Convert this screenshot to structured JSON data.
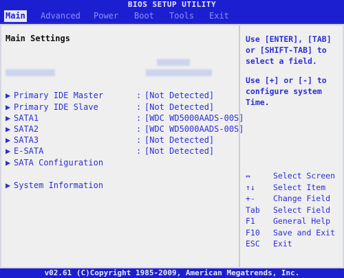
{
  "title": "BIOS SETUP UTILITY",
  "menu": {
    "tabs": [
      {
        "label": "Main"
      },
      {
        "label": "Advanced"
      },
      {
        "label": "Power"
      },
      {
        "label": "Boot"
      },
      {
        "label": "Tools"
      },
      {
        "label": "Exit"
      }
    ]
  },
  "main": {
    "heading": "Main Settings",
    "items": [
      {
        "label": "Primary IDE Master",
        "value": "[Not Detected]"
      },
      {
        "label": "Primary IDE Slave",
        "value": "[Not Detected]"
      },
      {
        "label": "SATA1",
        "value": "[WDC WD5000AADS-00S]"
      },
      {
        "label": "SATA2",
        "value": "[WDC WD5000AADS-00S]"
      },
      {
        "label": "SATA3",
        "value": "[Not Detected]"
      },
      {
        "label": "E-SATA",
        "value": "[Not Detected]"
      },
      {
        "label": "SATA Configuration"
      },
      {
        "label": "System Information"
      }
    ],
    "separator": ":",
    "arrow": "▶"
  },
  "help": {
    "line1": "Use [ENTER], [TAB] or [SHIFT-TAB] to select a field.",
    "line2": "Use [+] or [-] to configure system Time."
  },
  "keys": [
    {
      "key": "↔",
      "action": "Select Screen"
    },
    {
      "key": "↑↓",
      "action": "Select Item"
    },
    {
      "key": "+-",
      "action": "Change Field"
    },
    {
      "key": "Tab",
      "action": "Select Field"
    },
    {
      "key": "F1",
      "action": "General Help"
    },
    {
      "key": "F10",
      "action": "Save and Exit"
    },
    {
      "key": "ESC",
      "action": "Exit"
    }
  ],
  "footer": "v02.61 (C)Copyright 1985-2009, American Megatrends, Inc."
}
